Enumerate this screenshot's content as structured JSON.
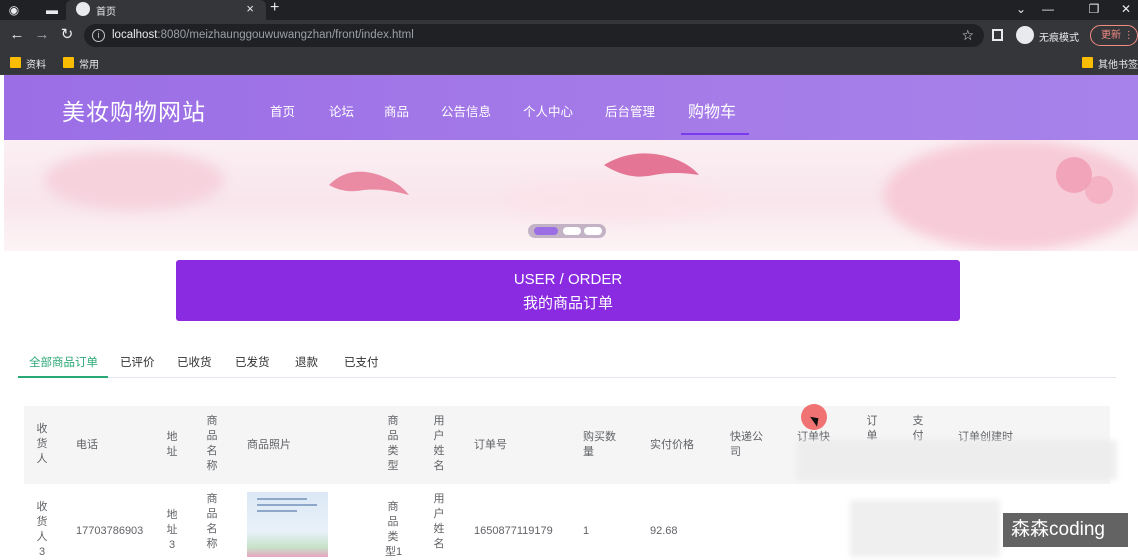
{
  "browser": {
    "tab_title": "首页",
    "tab_close": "×",
    "new_tab": "+",
    "url_host": "localhost",
    "url_rest": ":8080/meizhaunggouwuwangzhan/front/index.html",
    "incognito_label": "无痕模式",
    "update_label": "更新",
    "bookmarks": [
      "资料",
      "常用"
    ],
    "other_bookmarks": "其他书签"
  },
  "site": {
    "logo": "美妆购物网站",
    "nav": [
      "首页",
      "论坛",
      "商品",
      "公告信息",
      "个人中心",
      "后台管理",
      "购物车"
    ],
    "nav_active_index": 6
  },
  "page_title": {
    "en": "USER / ORDER",
    "cn": "我的商品订单",
    "color": "#8a2be2"
  },
  "order_tabs": {
    "items": [
      "全部商品订单",
      "已评价",
      "已收货",
      "已发货",
      "退款",
      "已支付"
    ],
    "active_index": 0,
    "active_color": "#2aa876"
  },
  "table": {
    "headers": {
      "receiver": "收\n货\n人",
      "phone": "电话",
      "address": "地\n址",
      "product_name": "商\n品\n名\n称",
      "product_photo": "商品照片",
      "product_type": "商\n品\n类\n型",
      "user_name": "用\n户\n姓\n名",
      "order_no": "订单号",
      "quantity": "购买数\n量",
      "actual_price": "实付价格",
      "courier": "快递公\n司",
      "tracking": "订单快",
      "order_state": "订\n单",
      "payment": "支\n付",
      "created": "订单创建时"
    },
    "rows": [
      {
        "receiver": "收\n货\n人\n3",
        "phone": "17703786903",
        "address": "地\n址\n3",
        "product_name": "商\n品\n名\n称",
        "product_type": "商\n品\n类\n型1",
        "user_name": "用\n户\n姓\n名",
        "order_no": "1650877119179",
        "quantity": "1",
        "actual_price": "92.68"
      }
    ]
  },
  "watermark": "森森coding"
}
